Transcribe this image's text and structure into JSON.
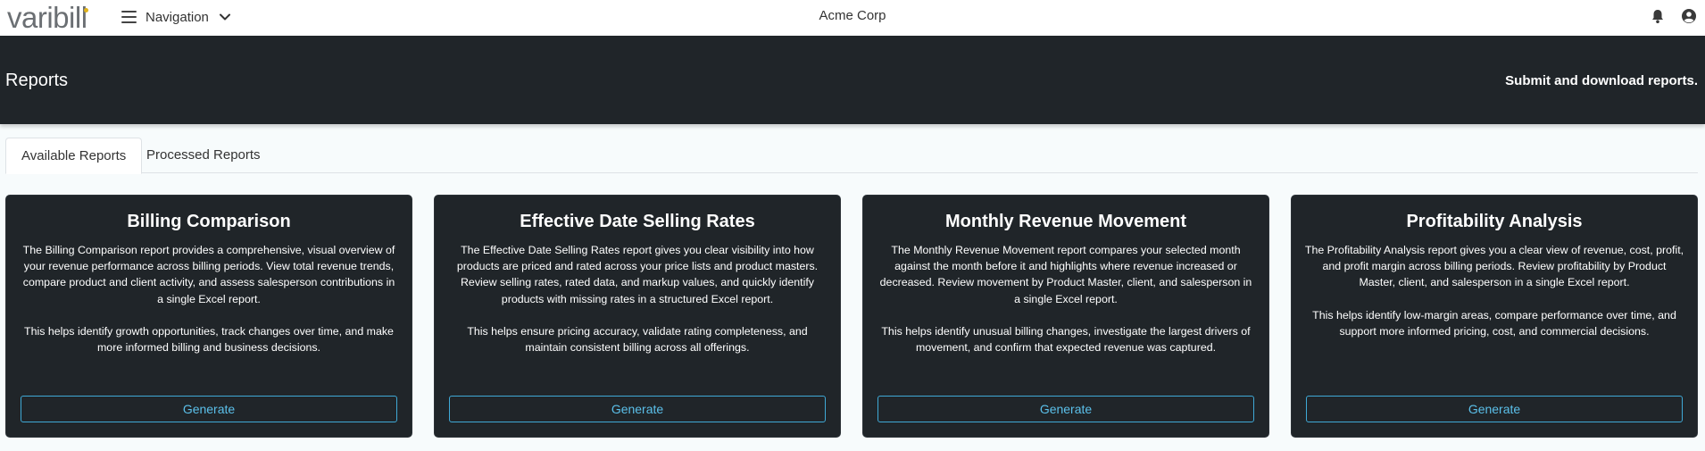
{
  "header": {
    "logo_text": "varibill",
    "nav_label": "Navigation",
    "org_name": "Acme Corp",
    "icons": {
      "menu": "hamburger-icon",
      "nav_dropdown": "chevron-down-icon",
      "notifications": "bell-icon",
      "account": "user-circle-icon"
    }
  },
  "banner": {
    "title": "Reports",
    "subtitle": "Submit and download reports."
  },
  "tabs": [
    {
      "label": "Available Reports",
      "active": true
    },
    {
      "label": "Processed Reports",
      "active": false
    }
  ],
  "cards": [
    {
      "title": "Billing Comparison",
      "desc1": "The Billing Comparison report provides a comprehensive, visual overview of your revenue performance across billing periods. View total revenue trends, compare product and client activity, and assess salesperson contributions in a single Excel report.",
      "desc2": "This helps identify growth opportunities, track changes over time, and make more informed billing and business decisions.",
      "button": "Generate"
    },
    {
      "title": "Effective Date Selling Rates",
      "desc1": "The Effective Date Selling Rates report gives you clear visibility into how products are priced and rated across your price lists and product masters. Review selling rates, rated data, and markup values, and quickly identify products with missing rates in a structured Excel report.",
      "desc2": "This helps ensure pricing accuracy, validate rating completeness, and maintain consistent billing across all offerings.",
      "button": "Generate"
    },
    {
      "title": "Monthly Revenue Movement",
      "desc1": "The Monthly Revenue Movement report compares your selected month against the month before it and highlights where revenue increased or decreased. Review movement by Product Master, client, and salesperson in a single Excel report.",
      "desc2": "This helps identify unusual billing changes, investigate the largest drivers of movement, and confirm that expected revenue was captured.",
      "button": "Generate"
    },
    {
      "title": "Profitability Analysis",
      "desc1": "The Profitability Analysis report gives you a clear view of revenue, cost, profit, and profit margin across billing periods. Review profitability by Product Master, client, and salesperson in a single Excel report.",
      "desc2": "This helps identify low-margin areas, compare performance over time, and support more informed pricing, cost, and commercial decisions.",
      "button": "Generate"
    }
  ],
  "colors": {
    "banner_bg": "#202529",
    "card_bg": "#202529",
    "accent": "#3fa9d6",
    "logo_dot": "#e0b21a"
  }
}
